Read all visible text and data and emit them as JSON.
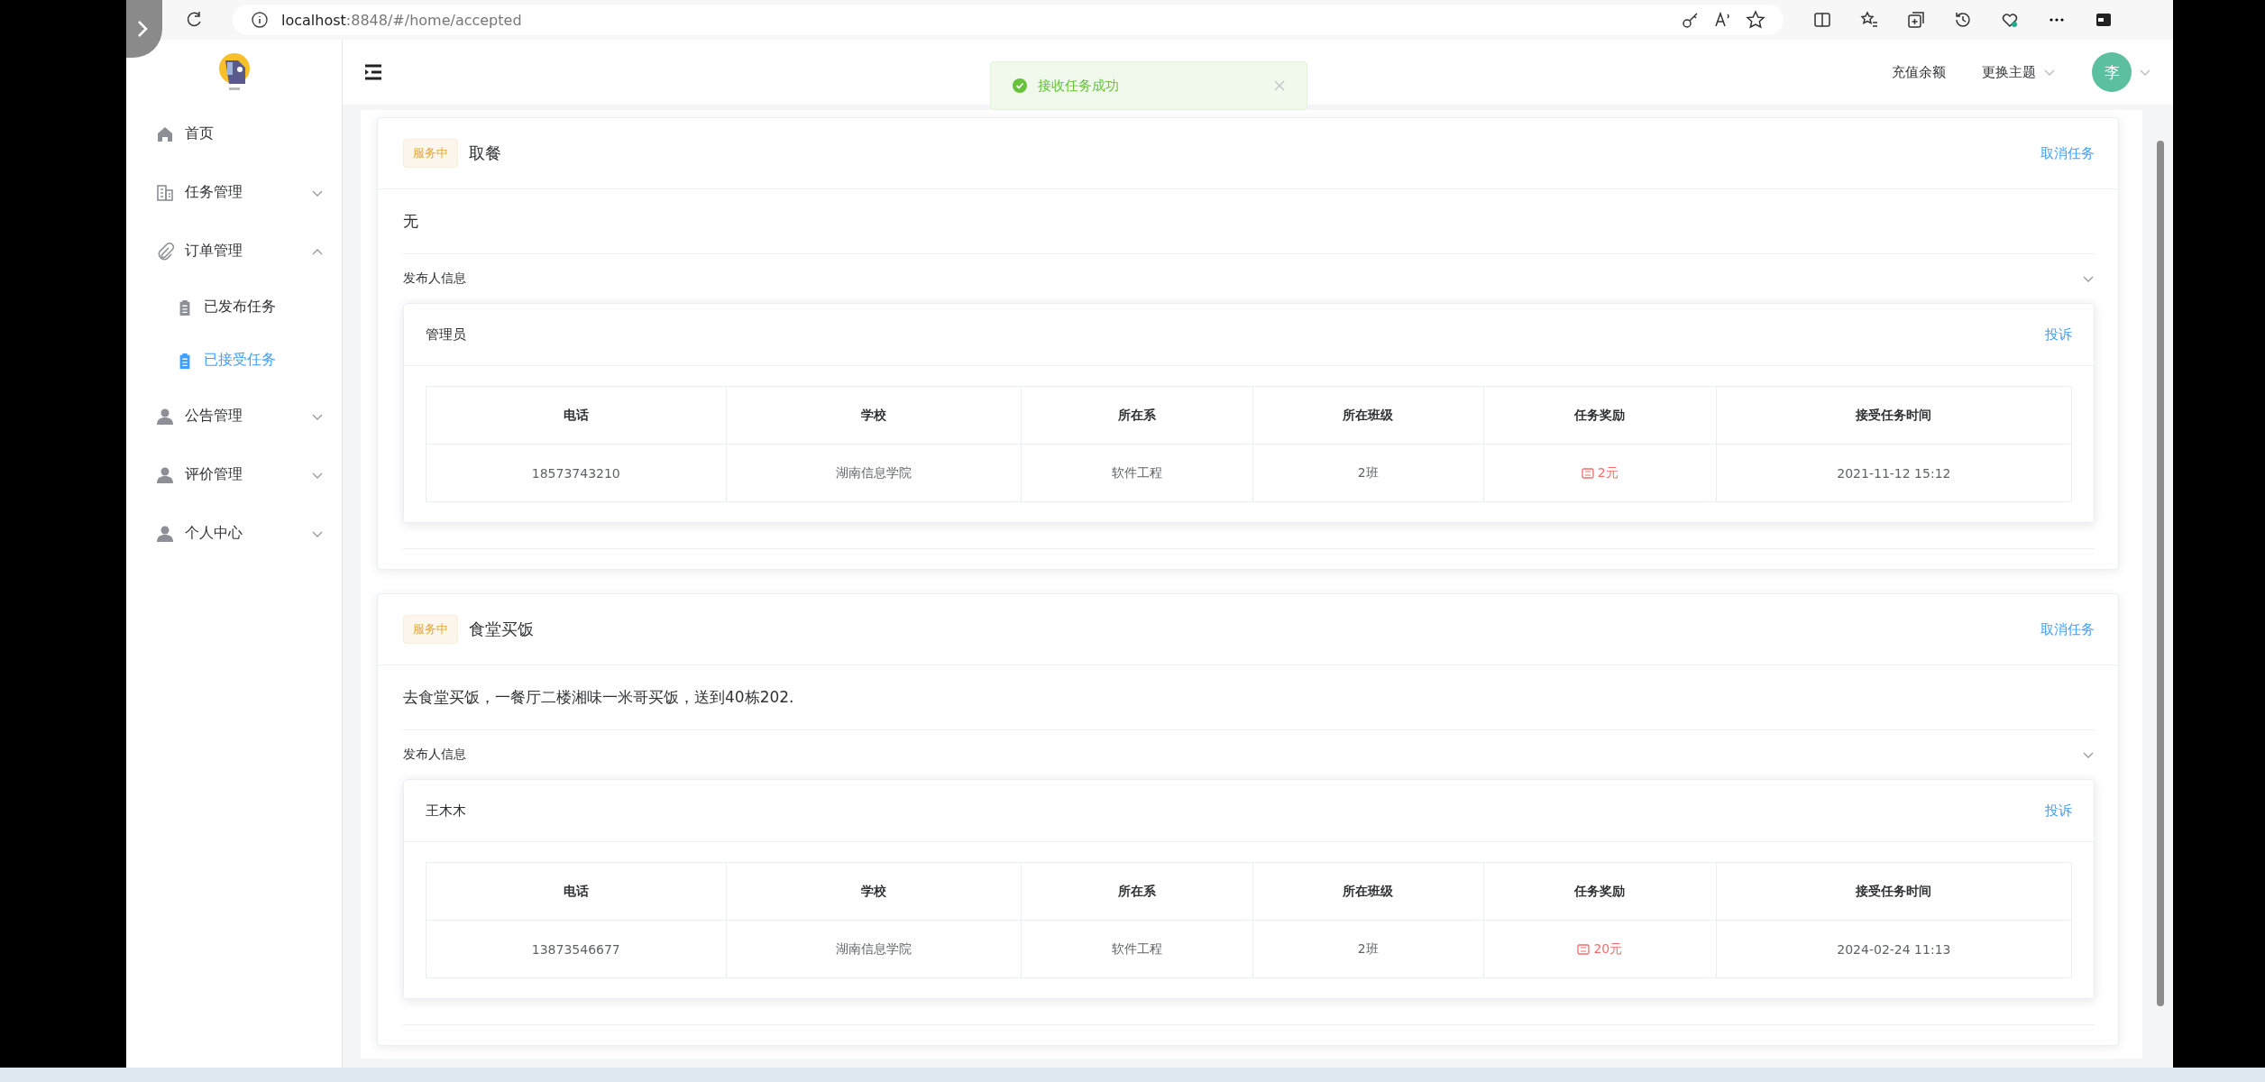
{
  "browser": {
    "url_host": "localhost",
    "url_rest": ":8848/#/home/accepted"
  },
  "sidebar": {
    "items": [
      {
        "label": "首页",
        "kind": "link",
        "selected": false
      },
      {
        "label": "任务管理",
        "kind": "submenu",
        "expanded": false
      },
      {
        "label": "订单管理",
        "kind": "submenu",
        "expanded": true,
        "children": [
          {
            "label": "已发布任务",
            "selected": false
          },
          {
            "label": "已接受任务",
            "selected": true
          }
        ]
      },
      {
        "label": "公告管理",
        "kind": "submenu",
        "expanded": false
      },
      {
        "label": "评价管理",
        "kind": "submenu",
        "expanded": false
      },
      {
        "label": "个人中心",
        "kind": "submenu",
        "expanded": false
      }
    ]
  },
  "header": {
    "links": [
      {
        "label": "充值余额",
        "dropdown": false
      },
      {
        "label": "更换主题",
        "dropdown": true
      }
    ],
    "avatar": "李"
  },
  "toast": {
    "message": "接收任务成功"
  },
  "tasks": [
    {
      "status": "服务中",
      "title": "取餐",
      "cancel": "取消任务",
      "description": "无",
      "publisher_section": "发布人信息",
      "expanded": true,
      "publisher": "管理员",
      "complain": "投诉",
      "columns": [
        "电话",
        "学校",
        "所在系",
        "所在班级",
        "任务奖励",
        "接受任务时间"
      ],
      "cells": [
        {
          "kind": "text",
          "text": "18573743210"
        },
        {
          "kind": "text",
          "text": "湖南信息学院"
        },
        {
          "kind": "text",
          "text": "软件工程"
        },
        {
          "kind": "text",
          "text": "2班"
        },
        {
          "kind": "reward",
          "text": "2元"
        },
        {
          "kind": "text",
          "text": "2021-11-12 15:12"
        }
      ]
    },
    {
      "status": "服务中",
      "title": "食堂买饭",
      "cancel": "取消任务",
      "description": "去食堂买饭，一餐厅二楼湘味一米哥买饭，送到40栋202.",
      "publisher_section": "发布人信息",
      "expanded": true,
      "publisher": "王木木",
      "complain": "投诉",
      "columns": [
        "电话",
        "学校",
        "所在系",
        "所在班级",
        "任务奖励",
        "接受任务时间"
      ],
      "cells": [
        {
          "kind": "text",
          "text": "13873546677"
        },
        {
          "kind": "text",
          "text": "湖南信息学院"
        },
        {
          "kind": "text",
          "text": "软件工程"
        },
        {
          "kind": "text",
          "text": "2班"
        },
        {
          "kind": "reward",
          "text": "20元"
        },
        {
          "kind": "text",
          "text": "2024-02-24 11:13"
        }
      ]
    }
  ]
}
